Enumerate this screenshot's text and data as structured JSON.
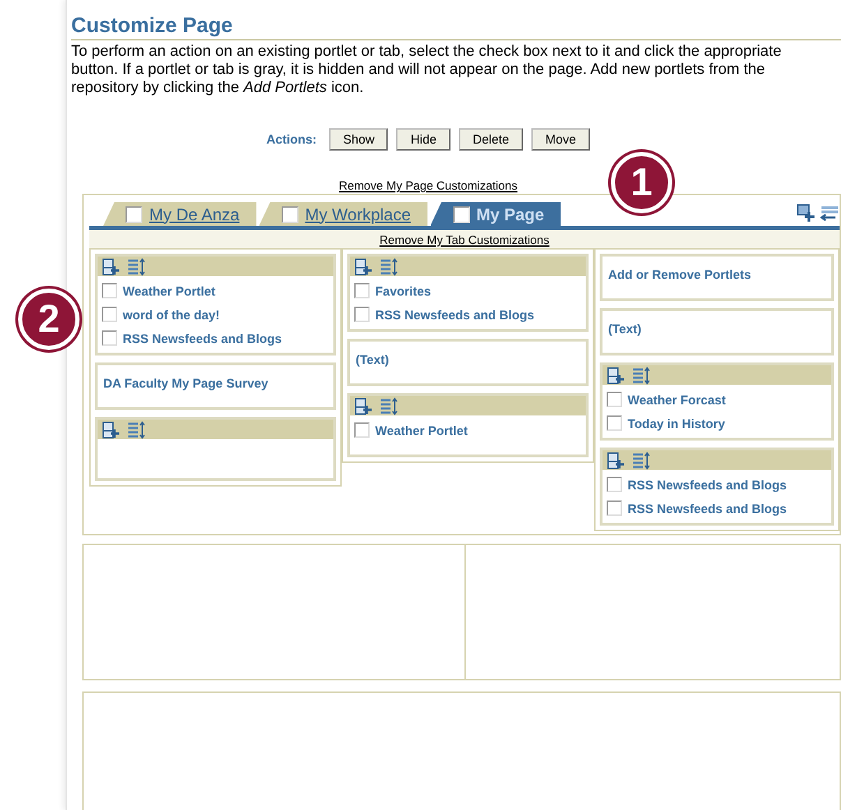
{
  "title": "Customize Page",
  "instructions": "To perform an action on an existing portlet or tab, select the check box next to it and click the appropriate button. If a portlet or tab is gray, it is hidden and will not appear on the page. Add new portlets from the repository by clicking the *Add Portlets* icon.",
  "actions": {
    "label": "Actions:",
    "buttons": [
      "Show",
      "Hide",
      "Delete",
      "Move"
    ]
  },
  "page_link": "Remove My Page Customizations",
  "tabs": [
    {
      "label": "My De Anza",
      "selected": false,
      "checked": false
    },
    {
      "label": "My Workplace",
      "selected": false,
      "checked": false
    },
    {
      "label": "My Page",
      "selected": true,
      "checked": false
    }
  ],
  "tab_link": "Remove My Tab Customizations",
  "columns": [
    [
      {
        "kind": "region",
        "items": [
          {
            "label": "Weather Portlet",
            "checked": false
          },
          {
            "label": "word of the day!",
            "checked": false
          },
          {
            "label": "RSS Newsfeeds and Blogs",
            "checked": false
          }
        ]
      },
      {
        "kind": "portlet",
        "label": "DA Faculty My Page Survey"
      },
      {
        "kind": "region"
      }
    ],
    [
      {
        "kind": "region",
        "items": [
          {
            "label": "Favorites",
            "checked": false
          },
          {
            "label": "RSS Newsfeeds and Blogs",
            "checked": false
          }
        ]
      },
      {
        "kind": "portlet",
        "label": "(Text)"
      },
      {
        "kind": "region",
        "items": [
          {
            "label": "Weather Portlet",
            "checked": false
          }
        ]
      }
    ],
    [
      {
        "kind": "portlet",
        "label": "Add or Remove Portlets"
      },
      {
        "kind": "portlet",
        "label": "(Text)"
      },
      {
        "kind": "region",
        "items": [
          {
            "label": "Weather Forcast",
            "checked": false
          },
          {
            "label": "Today in History",
            "checked": false
          }
        ]
      },
      {
        "kind": "region",
        "items": [
          {
            "label": "RSS Newsfeeds and Blogs",
            "checked": false
          },
          {
            "label": "RSS Newsfeeds and Blogs",
            "checked": false
          }
        ]
      }
    ]
  ],
  "callouts": [
    {
      "label": "1"
    },
    {
      "label": "2"
    }
  ]
}
